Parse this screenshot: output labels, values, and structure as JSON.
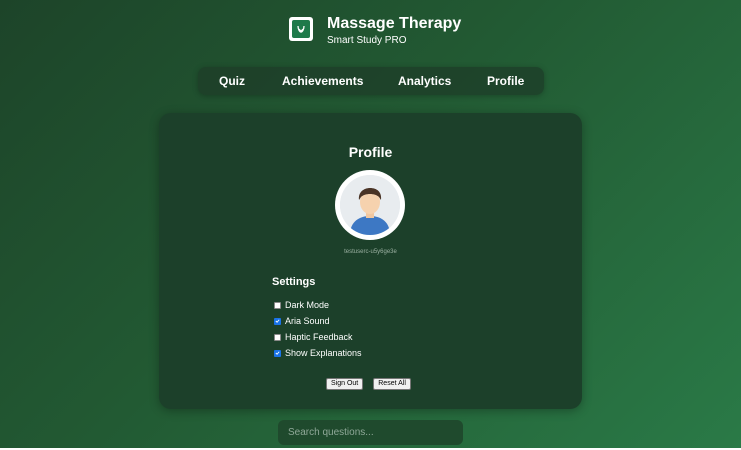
{
  "header": {
    "title": "Massage Therapy",
    "subtitle": "Smart Study PRO",
    "logo_icon": "leaf-logo-icon"
  },
  "nav": {
    "items": [
      {
        "label": "Quiz"
      },
      {
        "label": "Achievements"
      },
      {
        "label": "Analytics"
      },
      {
        "label": "Profile"
      }
    ]
  },
  "profile": {
    "title": "Profile",
    "avatar_icon": "user-avatar-icon",
    "username": "testuserc-u5y6ge3e",
    "settings_title": "Settings",
    "settings": [
      {
        "label": "Dark Mode",
        "checked": false
      },
      {
        "label": "Aria Sound",
        "checked": true
      },
      {
        "label": "Haptic Feedback",
        "checked": false
      },
      {
        "label": "Show Explanations",
        "checked": true
      }
    ],
    "sign_out_label": "Sign Out",
    "reset_all_label": "Reset All"
  },
  "search": {
    "placeholder": "Search questions..."
  },
  "colors": {
    "background_start": "#1d4429",
    "background_end": "#2a7a47",
    "card": "#1c402a",
    "checkbox_checked": "#1a73e8"
  }
}
